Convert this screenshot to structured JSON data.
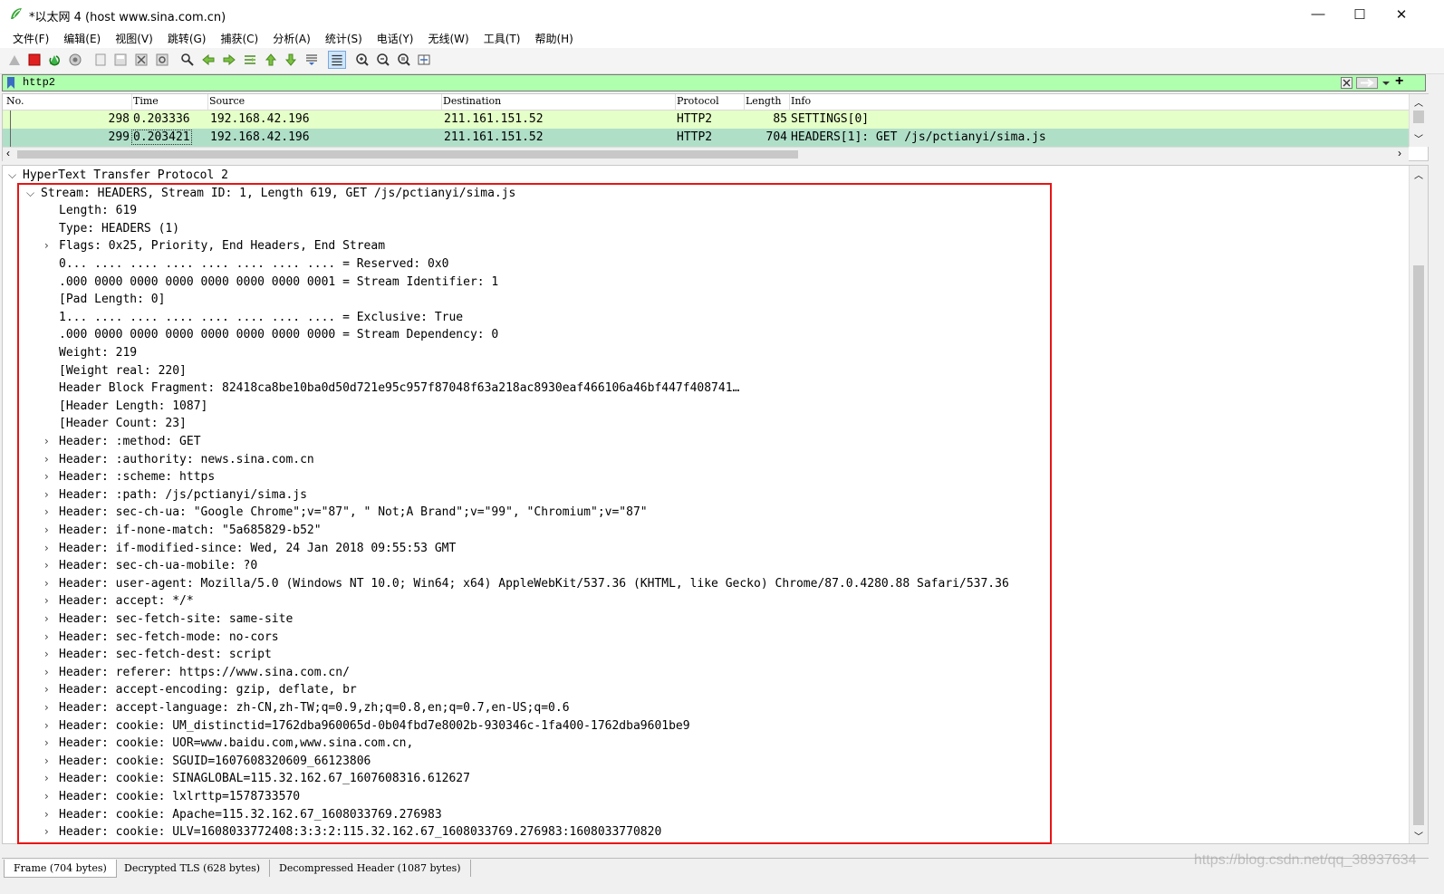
{
  "window": {
    "title": "*以太网 4 (host www.sina.com.cn)",
    "minimize": "—",
    "maximize": "☐",
    "close": "✕"
  },
  "menu": [
    "文件(F)",
    "编辑(E)",
    "视图(V)",
    "跳转(G)",
    "捕获(C)",
    "分析(A)",
    "统计(S)",
    "电话(Y)",
    "无线(W)",
    "工具(T)",
    "帮助(H)"
  ],
  "toolbar": {
    "icons": [
      "shark-fin-start-icon",
      "stop-capture-icon",
      "restart-capture-icon",
      "capture-options-icon",
      "open-file-icon",
      "save-file-icon",
      "close-file-icon",
      "reload-file-icon",
      "find-packet-icon",
      "go-back-icon",
      "go-forward-icon",
      "go-to-packet-icon",
      "first-packet-icon",
      "last-packet-icon",
      "auto-scroll-icon",
      "colorize-icon",
      "zoom-in-icon",
      "zoom-out-icon",
      "normal-size-icon",
      "resize-columns-icon"
    ]
  },
  "filter": {
    "value": "http2",
    "bg_color": "#afffaf"
  },
  "packet_list": {
    "columns": [
      "No.",
      "Time",
      "Source",
      "Destination",
      "Protocol",
      "Length",
      "Info"
    ],
    "rows": [
      {
        "no": "298",
        "time": "0.203336",
        "source": "192.168.42.196",
        "destination": "211.161.151.52",
        "protocol": "HTTP2",
        "length": "85",
        "info": "SETTINGS[0]",
        "color": "#e4ffc7"
      },
      {
        "no": "299",
        "time": "0.203421",
        "source": "192.168.42.196",
        "destination": "211.161.151.52",
        "protocol": "HTTP2",
        "length": "704",
        "info": "HEADERS[1]: GET /js/pctianyi/sima.js",
        "color": "#b0dfc8"
      }
    ]
  },
  "details": {
    "lines": [
      {
        "text": "HyperText Transfer Protocol 2",
        "indent": 0,
        "arrow": "down"
      },
      {
        "text": "Stream: HEADERS, Stream ID: 1, Length 619, GET /js/pctianyi/sima.js",
        "indent": 1,
        "arrow": "down"
      },
      {
        "text": "Length: 619",
        "indent": 2,
        "arrow": ""
      },
      {
        "text": "Type: HEADERS (1)",
        "indent": 2,
        "arrow": ""
      },
      {
        "text": "Flags: 0x25, Priority, End Headers, End Stream",
        "indent": 2,
        "arrow": "right"
      },
      {
        "text": "0... .... .... .... .... .... .... .... = Reserved: 0x0",
        "indent": 2,
        "arrow": ""
      },
      {
        "text": ".000 0000 0000 0000 0000 0000 0000 0001 = Stream Identifier: 1",
        "indent": 2,
        "arrow": ""
      },
      {
        "text": "[Pad Length: 0]",
        "indent": 2,
        "arrow": ""
      },
      {
        "text": "1... .... .... .... .... .... .... .... = Exclusive: True",
        "indent": 2,
        "arrow": ""
      },
      {
        "text": ".000 0000 0000 0000 0000 0000 0000 0000 = Stream Dependency: 0",
        "indent": 2,
        "arrow": ""
      },
      {
        "text": "Weight: 219",
        "indent": 2,
        "arrow": ""
      },
      {
        "text": "[Weight real: 220]",
        "indent": 2,
        "arrow": ""
      },
      {
        "text": "Header Block Fragment: 82418ca8be10ba0d50d721e95c957f87048f63a218ac8930eaf466106a46bf447f408741…",
        "indent": 2,
        "arrow": ""
      },
      {
        "text": "[Header Length: 1087]",
        "indent": 2,
        "arrow": ""
      },
      {
        "text": "[Header Count: 23]",
        "indent": 2,
        "arrow": ""
      },
      {
        "text": "Header: :method: GET",
        "indent": 2,
        "arrow": "right"
      },
      {
        "text": "Header: :authority: news.sina.com.cn",
        "indent": 2,
        "arrow": "right"
      },
      {
        "text": "Header: :scheme: https",
        "indent": 2,
        "arrow": "right"
      },
      {
        "text": "Header: :path: /js/pctianyi/sima.js",
        "indent": 2,
        "arrow": "right"
      },
      {
        "text": "Header: sec-ch-ua: \"Google Chrome\";v=\"87\", \" Not;A Brand\";v=\"99\", \"Chromium\";v=\"87\"",
        "indent": 2,
        "arrow": "right"
      },
      {
        "text": "Header: if-none-match: \"5a685829-b52\"",
        "indent": 2,
        "arrow": "right"
      },
      {
        "text": "Header: if-modified-since: Wed, 24 Jan 2018 09:55:53 GMT",
        "indent": 2,
        "arrow": "right"
      },
      {
        "text": "Header: sec-ch-ua-mobile: ?0",
        "indent": 2,
        "arrow": "right"
      },
      {
        "text": "Header: user-agent: Mozilla/5.0 (Windows NT 10.0; Win64; x64) AppleWebKit/537.36 (KHTML, like Gecko) Chrome/87.0.4280.88 Safari/537.36",
        "indent": 2,
        "arrow": "right"
      },
      {
        "text": "Header: accept: */*",
        "indent": 2,
        "arrow": "right"
      },
      {
        "text": "Header: sec-fetch-site: same-site",
        "indent": 2,
        "arrow": "right"
      },
      {
        "text": "Header: sec-fetch-mode: no-cors",
        "indent": 2,
        "arrow": "right"
      },
      {
        "text": "Header: sec-fetch-dest: script",
        "indent": 2,
        "arrow": "right"
      },
      {
        "text": "Header: referer: https://www.sina.com.cn/",
        "indent": 2,
        "arrow": "right"
      },
      {
        "text": "Header: accept-encoding: gzip, deflate, br",
        "indent": 2,
        "arrow": "right"
      },
      {
        "text": "Header: accept-language: zh-CN,zh-TW;q=0.9,zh;q=0.8,en;q=0.7,en-US;q=0.6",
        "indent": 2,
        "arrow": "right"
      },
      {
        "text": "Header: cookie: UM_distinctid=1762dba960065d-0b04fbd7e8002b-930346c-1fa400-1762dba9601be9",
        "indent": 2,
        "arrow": "right"
      },
      {
        "text": "Header: cookie: UOR=www.baidu.com,www.sina.com.cn,",
        "indent": 2,
        "arrow": "right"
      },
      {
        "text": "Header: cookie: SGUID=1607608320609_66123806",
        "indent": 2,
        "arrow": "right"
      },
      {
        "text": "Header: cookie: SINAGLOBAL=115.32.162.67_1607608316.612627",
        "indent": 2,
        "arrow": "right"
      },
      {
        "text": "Header: cookie: lxlrttp=1578733570",
        "indent": 2,
        "arrow": "right"
      },
      {
        "text": "Header: cookie: Apache=115.32.162.67_1608033769.276983",
        "indent": 2,
        "arrow": "right"
      },
      {
        "text": "Header: cookie: ULV=1608033772408:3:3:2:115.32.162.67_1608033769.276983:1608033770820",
        "indent": 2,
        "arrow": "right"
      }
    ]
  },
  "status_tabs": [
    "Frame (704 bytes)",
    "Decrypted TLS (628 bytes)",
    "Decompressed Header (1087 bytes)"
  ],
  "watermark": "https://blog.csdn.net/qq_38937634",
  "colors": {
    "highlight": "#e81515",
    "filter_ok": "#afffaf"
  }
}
